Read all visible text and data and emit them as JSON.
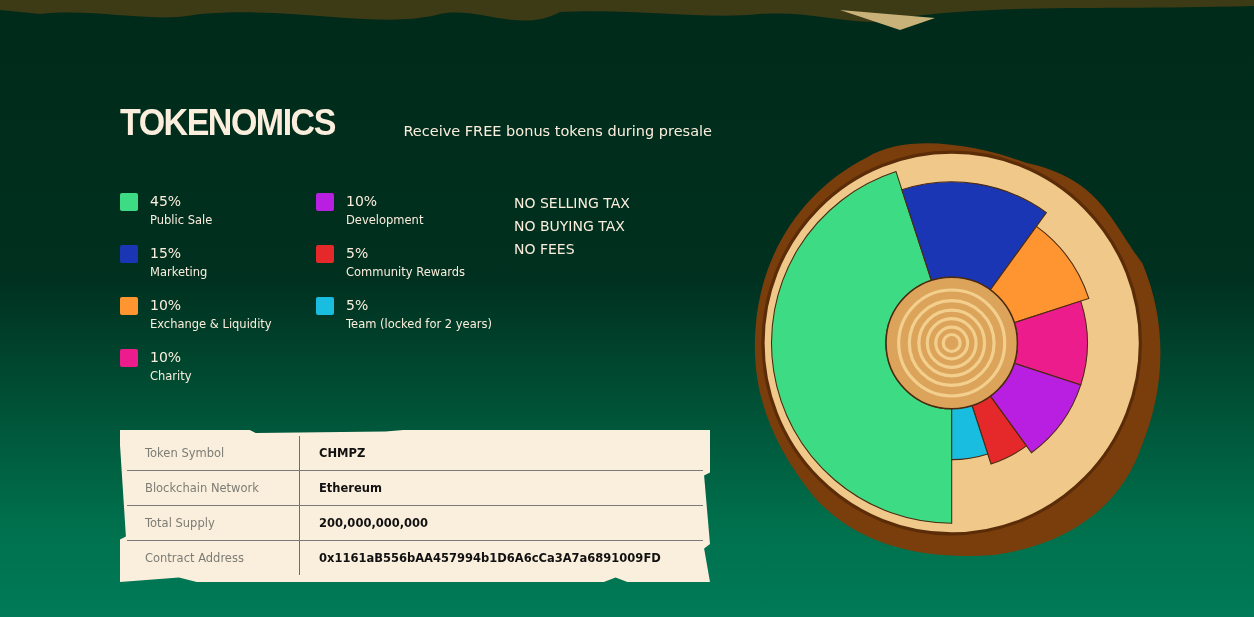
{
  "heading": {
    "title": "TOKENOMICS",
    "subtitle": "Receive FREE bonus tokens during presale"
  },
  "allocations": [
    {
      "percent": "45%",
      "label": "Public Sale",
      "color": "#3ddc84"
    },
    {
      "percent": "15%",
      "label": "Marketing",
      "color": "#1a36b4"
    },
    {
      "percent": "10%",
      "label": "Exchange & Liquidity",
      "color": "#ff9530"
    },
    {
      "percent": "10%",
      "label": "Charity",
      "color": "#ec1c8c"
    },
    {
      "percent": "10%",
      "label": "Development",
      "color": "#b91fe0"
    },
    {
      "percent": "5%",
      "label": "Community Rewards",
      "color": "#e5282a"
    },
    {
      "percent": "5%",
      "label": "Team (locked for 2 years)",
      "color": "#18bde0"
    }
  ],
  "tax_notes": [
    "NO SELLING TAX",
    "NO BUYING TAX",
    "NO FEES"
  ],
  "token_info": [
    {
      "label": "Token Symbol",
      "value": "CHMPZ"
    },
    {
      "label": "Blockchain Network",
      "value": "Ethereum"
    },
    {
      "label": "Total Supply",
      "value": "200,000,000,000"
    },
    {
      "label": "Contract Address",
      "value": "0x1161aB556bAA457994b1D6A6cCa3A7a6891009FD"
    }
  ]
}
